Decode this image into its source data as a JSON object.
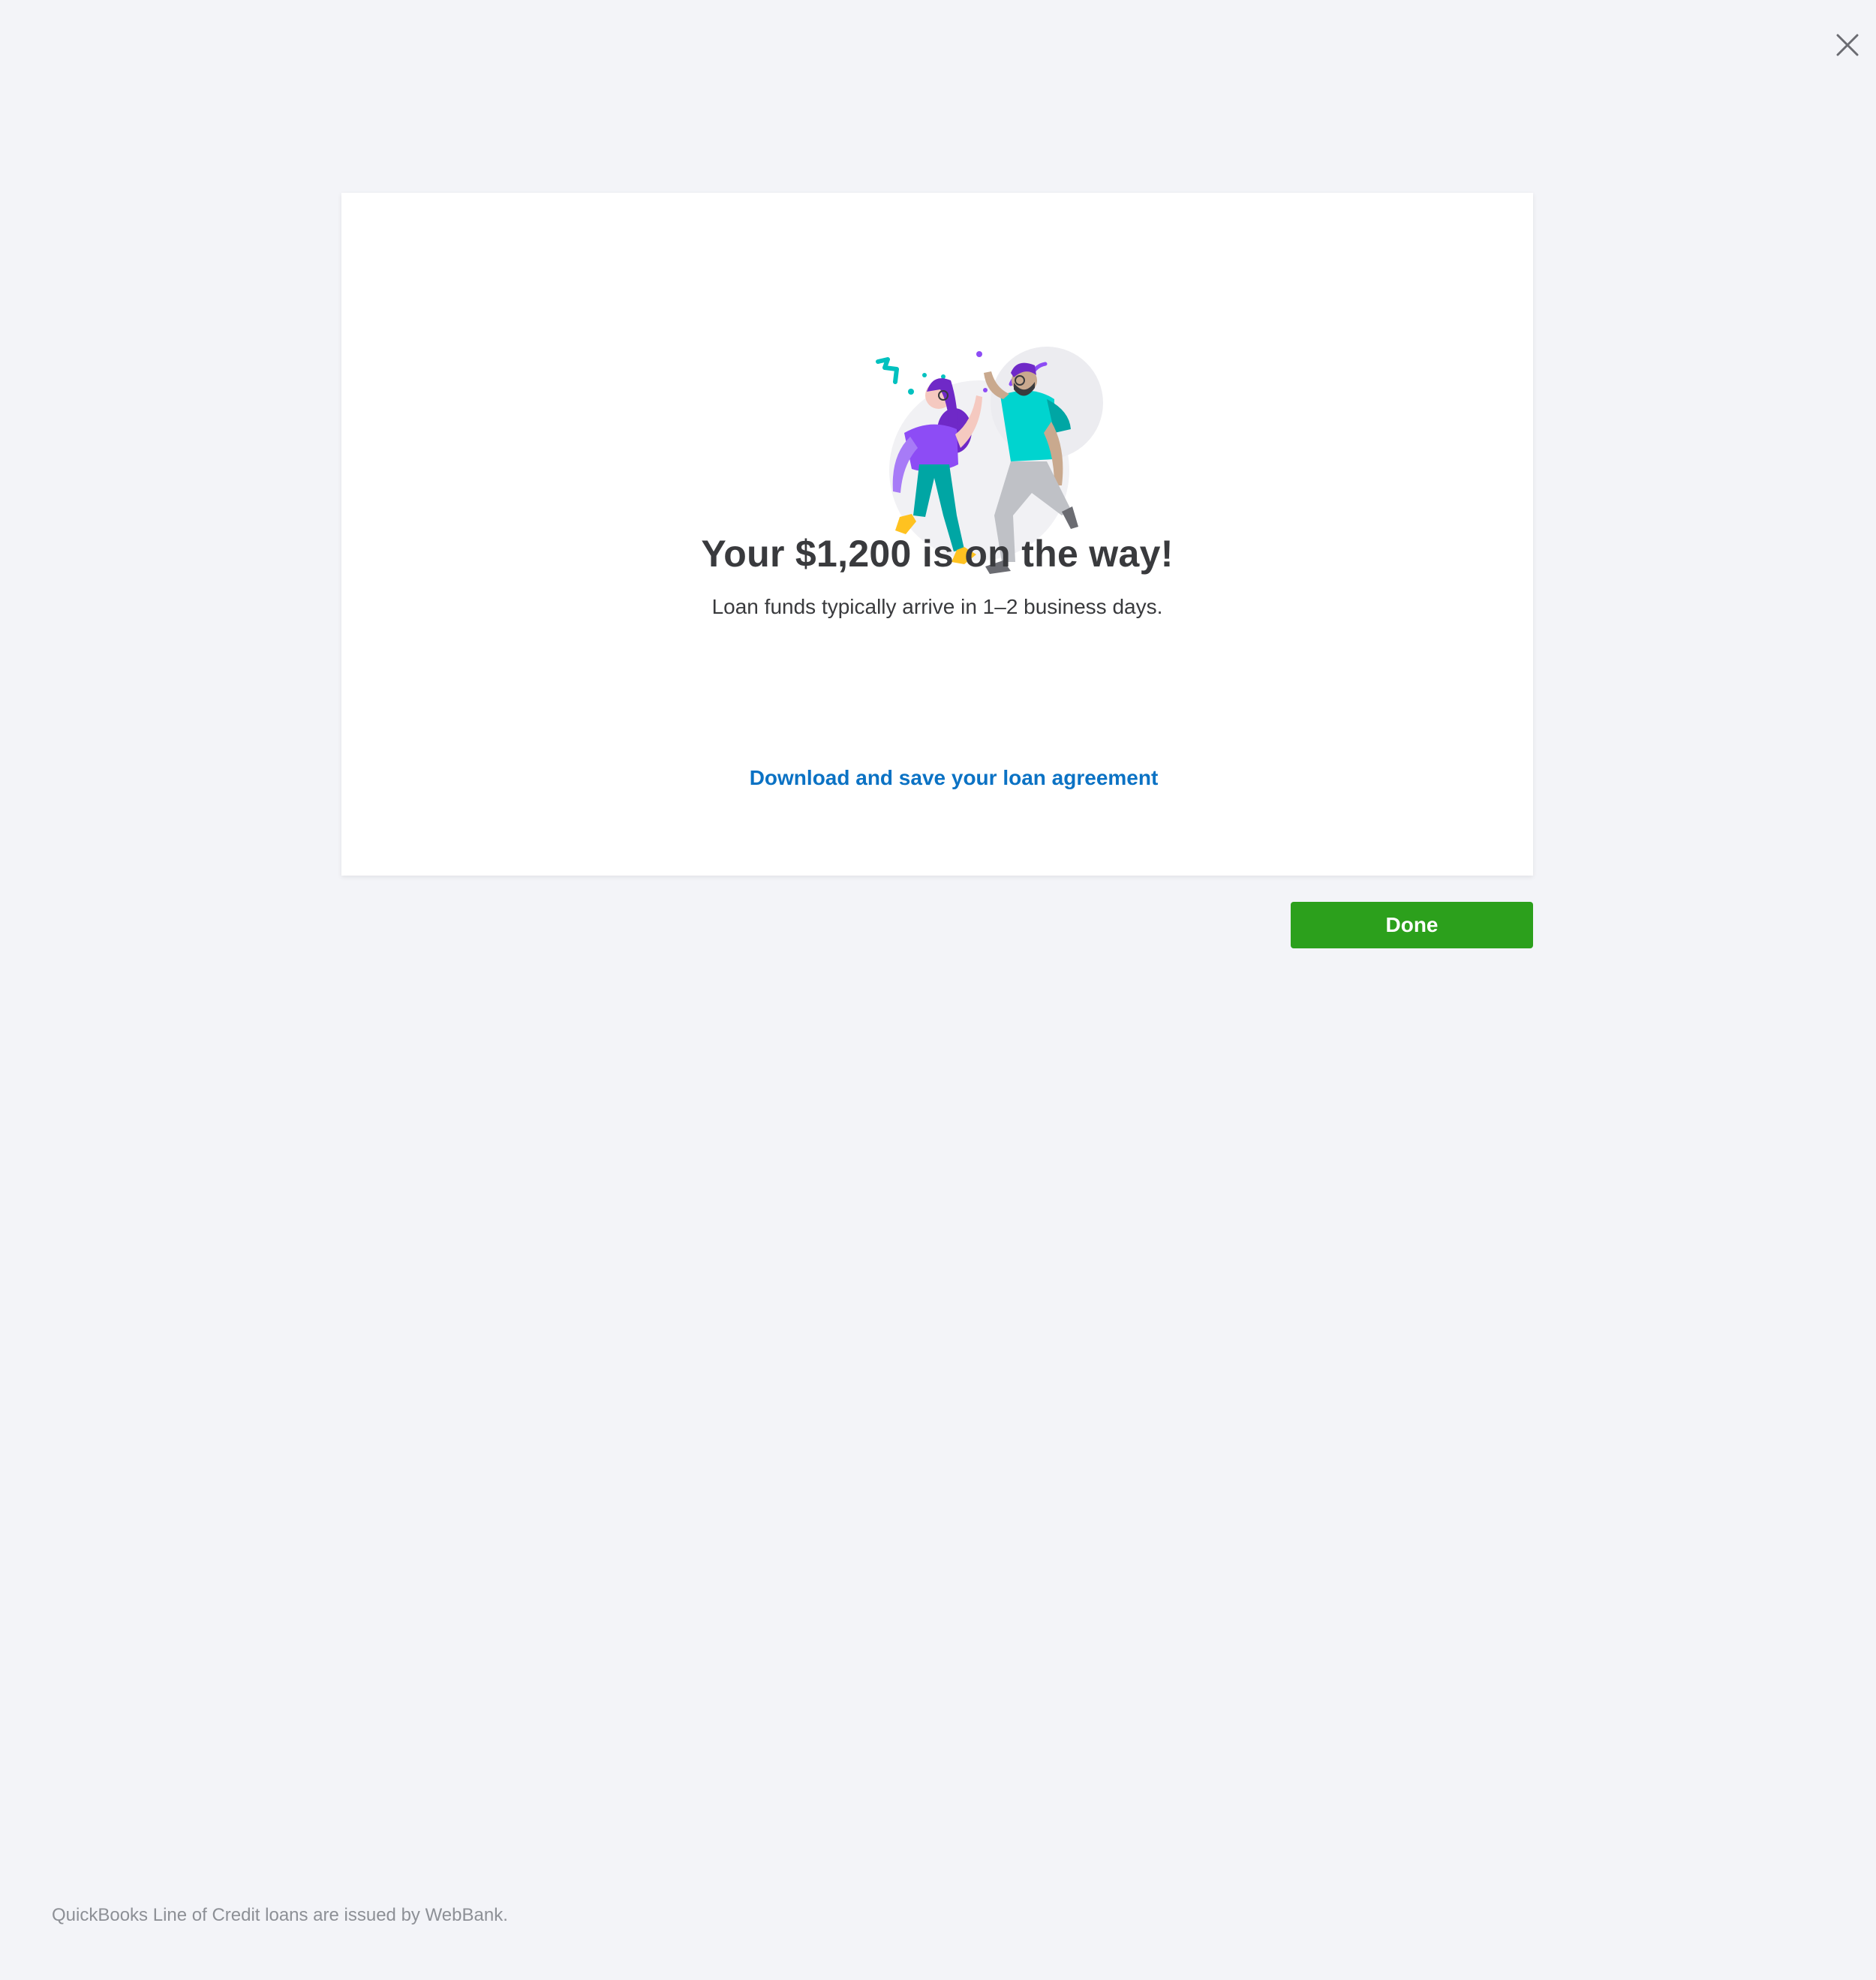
{
  "header": {
    "close_icon": "close-icon"
  },
  "card": {
    "illustration": "celebration-high-five-illustration",
    "headline": "Your $1,200 is on the way!",
    "subtext": "Loan funds typically arrive in 1–2 business days.",
    "agreement_link": "Download and save your loan agreement"
  },
  "actions": {
    "done_label": "Done"
  },
  "footer": {
    "disclaimer": "QuickBooks Line of Credit loans are issued by WebBank."
  },
  "colors": {
    "background": "#f3f4f8",
    "primary_button": "#2ca01c",
    "link": "#0b72c4",
    "text": "#393a3d",
    "muted_text": "#8d9096"
  }
}
